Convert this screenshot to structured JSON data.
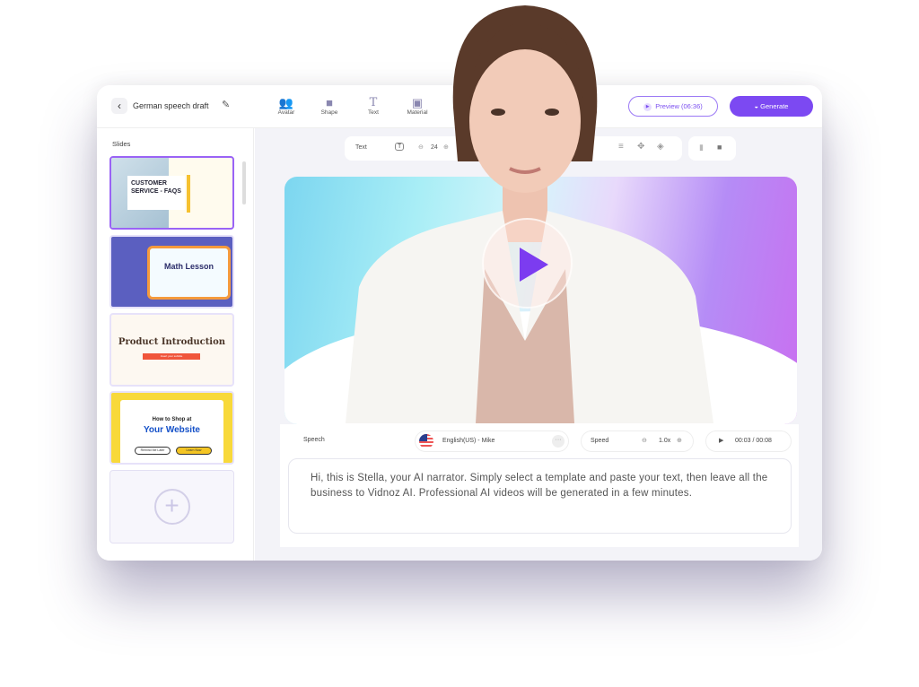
{
  "header": {
    "back_icon": "chevron-left-icon",
    "project_title": "German speech draft",
    "edit_icon": "pencil-icon",
    "tools": [
      {
        "label": "Avatar",
        "icon": "people-icon"
      },
      {
        "label": "Shape",
        "icon": "shapes-icon"
      },
      {
        "label": "Text",
        "icon": "text-icon"
      },
      {
        "label": "Material",
        "icon": "image-icon"
      }
    ],
    "preview_label": "Preview (06:36)",
    "generate_label": "Generate"
  },
  "sidebar": {
    "label": "Slides",
    "slides": [
      {
        "title": "CUSTOMER SERVICE - FAQS",
        "selected": true
      },
      {
        "title": "Math Lesson"
      },
      {
        "title": "Product Introduction",
        "button": "Insert your subtitle"
      },
      {
        "subtitle": "How to Shop at",
        "title": "Your Website",
        "buttons": [
          "Remind Me Later",
          "Learn Now"
        ]
      }
    ],
    "add_icon": "plus-circle-icon"
  },
  "text_toolbar": {
    "label": "Text",
    "font_size": "24"
  },
  "speech": {
    "label": "Speech",
    "voice": "English(US) - Mike",
    "speed_label": "Speed",
    "speed": "1.0x",
    "time": "00:03 / 00:08",
    "text": "Hi, this is Stella, your AI narrator. Simply select a template and paste your text, then leave all the business to Vidnoz AI. Professional AI videos will be generated in a few minutes."
  },
  "colors": {
    "accent": "#7c49f2"
  }
}
